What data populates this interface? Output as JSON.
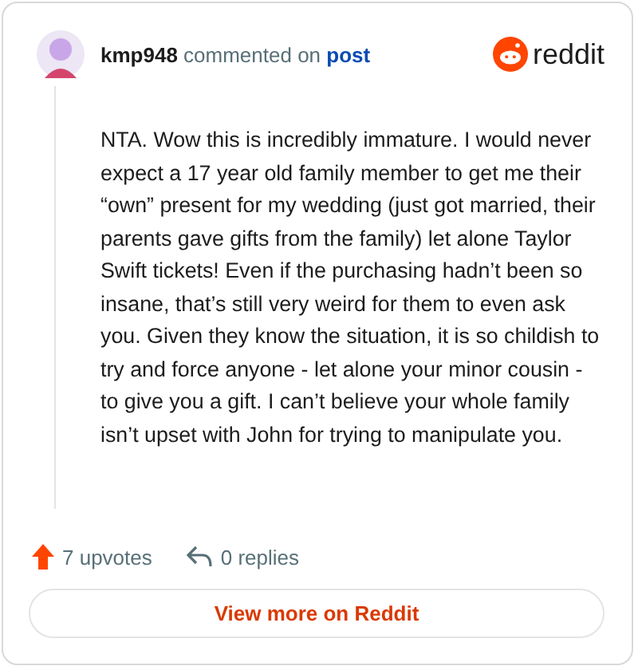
{
  "comment": {
    "author": "kmp948",
    "action": "commented on",
    "target": "post",
    "body": "NTA. Wow this is incredibly immature. I would never expect a 17 year old family member to get me their “own” present for my wedding (just got married, their parents gave gifts from the family) let alone Taylor Swift tickets! Even if the purchasing hadn’t been so insane, that’s still very weird for them to even ask you. Given they know the situation, it is so childish to try and force anyone - let alone your minor cousin - to give you a gift. I can’t believe your whole family isn’t upset with John for trying to manipulate you.",
    "upvotes": "7 upvotes",
    "replies": "0 replies"
  },
  "brand": "reddit",
  "button": "View more on Reddit"
}
